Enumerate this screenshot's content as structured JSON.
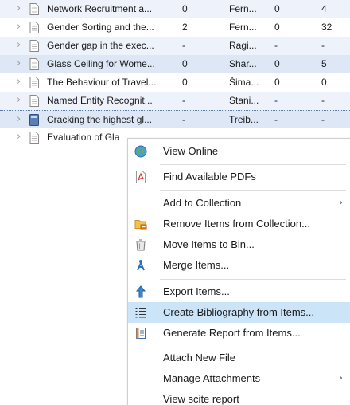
{
  "items": [
    {
      "title": "Network Recruitment a...",
      "c1": "0",
      "creator": "Fern...",
      "c3": "0",
      "c4": "4"
    },
    {
      "title": "Gender Sorting and the...",
      "c1": "2",
      "creator": "Fern...",
      "c3": "0",
      "c4": "32"
    },
    {
      "title": "Gender gap in the exec...",
      "c1": "-",
      "creator": "Ragi...",
      "c3": "-",
      "c4": "-"
    },
    {
      "title": "Glass Ceiling for Wome...",
      "c1": "0",
      "creator": "Shar...",
      "c3": "0",
      "c4": "5"
    },
    {
      "title": "The Behaviour of Travel...",
      "c1": "0",
      "creator": "Šima...",
      "c3": "0",
      "c4": "0"
    },
    {
      "title": "Named Entity Recognit...",
      "c1": "-",
      "creator": "Stani...",
      "c3": "-",
      "c4": "-"
    },
    {
      "title": "Cracking the highest gl...",
      "c1": "-",
      "creator": "Treib...",
      "c3": "-",
      "c4": "-"
    },
    {
      "title": "Evaluation of Gla",
      "c1": "",
      "creator": "",
      "c3": "",
      "c4": ""
    }
  ],
  "context_menu": {
    "view_online": "View Online",
    "find_pdfs": "Find Available PDFs",
    "add_to_collection": "Add to Collection",
    "remove_from_collection": "Remove Items from Collection...",
    "move_to_bin": "Move Items to Bin...",
    "merge_items": "Merge Items...",
    "export_items": "Export Items...",
    "create_bibliography": "Create Bibliography from Items...",
    "generate_report": "Generate Report from Items...",
    "attach_new_file": "Attach New File",
    "manage_attachments": "Manage Attachments",
    "view_scite": "View scite report",
    "submenu_arrow": "›"
  },
  "icons": {
    "expand": "chevron-right-icon",
    "document": "document-icon",
    "book": "book-icon",
    "globe": "globe-icon",
    "pdf": "pdf-icon",
    "folder_remove": "folder-remove-icon",
    "bin": "bin-icon",
    "merge": "merge-icon",
    "export": "export-icon",
    "bibliography": "bibliography-icon",
    "report": "report-icon"
  },
  "colors": {
    "row_alt": "#eef3fb",
    "menu_highlight": "#cce4f7"
  }
}
